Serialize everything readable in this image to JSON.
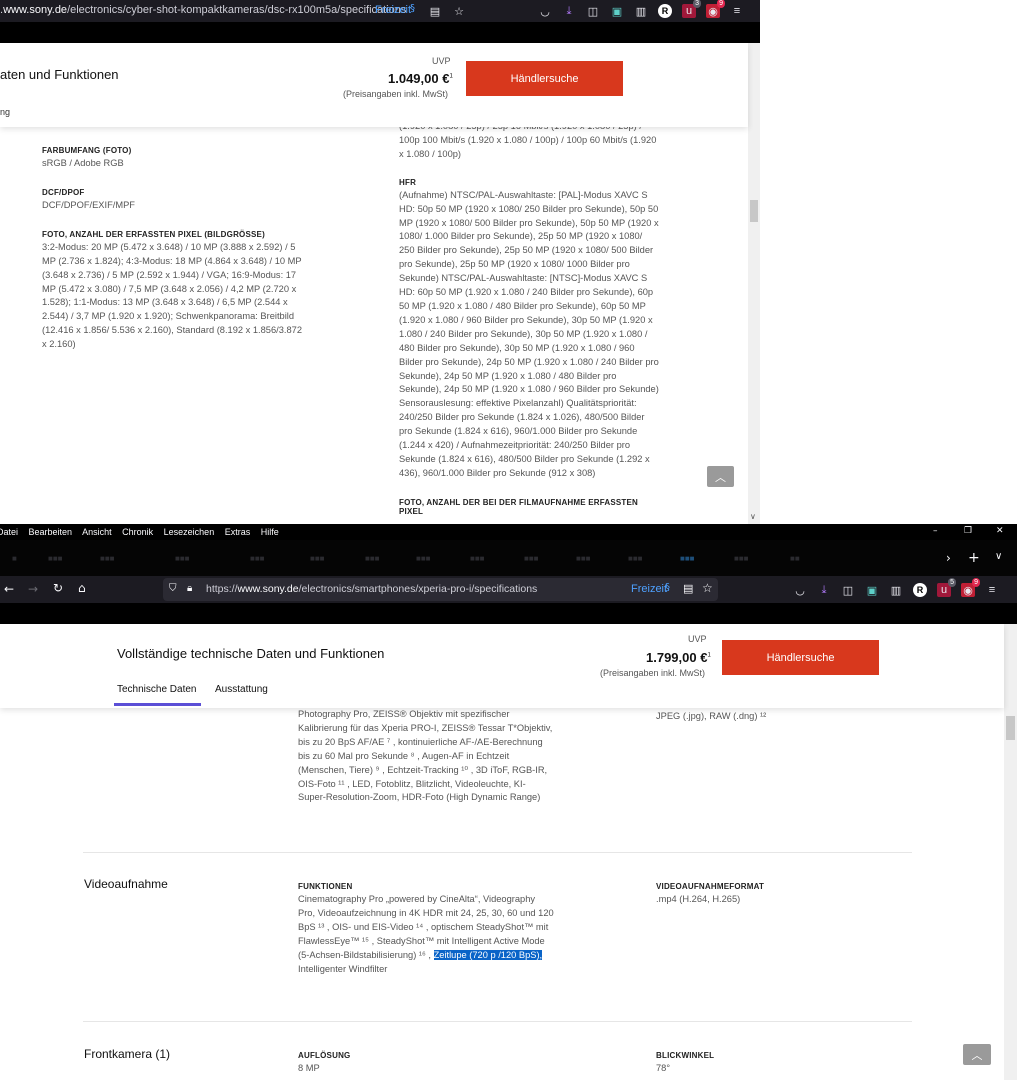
{
  "top_window": {
    "url_host": "www.sony.de",
    "url_path": "/electronics/cyber-shot-kompaktkameras/dsc-rx100m5a/specifications",
    "url_prefix": ".",
    "freizeit_label": "Freizeit",
    "toolbar_badges": {
      "ext1": "3",
      "ext2": "9"
    },
    "header": {
      "title": "aten und Funktionen",
      "tab_fragment": "ng",
      "uvp": "UVP",
      "price": "1.049,00 €",
      "price_sup": "1",
      "inkl": "(Preisangaben inkl. MwSt)",
      "button": "Händlersuche"
    },
    "left_specs": [
      {
        "label": "FARBUMFANG (FOTO)",
        "value": "sRGB / Adobe RGB"
      },
      {
        "label": "DCF/DPOF",
        "value": "DCF/DPOF/EXIF/MPF"
      },
      {
        "label": "FOTO, ANZAHL DER ERFASSTEN PIXEL (BILDGRÖSSE)",
        "value": "3:2-Modus: 20 MP (5.472 x 3.648) / 10 MP (3.888 x 2.592) / 5 MP (2.736 x 1.824); 4:3-Modus: 18 MP (4.864 x 3.648) / 10 MP (3.648 x 2.736) / 5 MP (2.592 x 1.944) / VGA; 16:9-Modus: 17 MP (5.472 x 3.080) / 7,5 MP (3.648 x 2.056) / 4,2 MP (2.720 x 1.528); 1:1-Modus: 13 MP (3.648 x 3.648) / 6,5 MP (2.544 x 2.544) / 3,7 MP (1.920 x 1.920); Schwenkpanorama: Breitbild (12.416 x 1.856/ 5.536 x 2.160), Standard (8.192 x 1.856/3.872 x 2.160)"
      }
    ],
    "right_top_cut": "(1.920 x 1.080 / 25p) / 25p 16 Mbit/s (1.920 x 1.080 / 25p) / 100p 100 Mbit/s (1.920 x 1.080 / 100p) / 100p 60 Mbit/s (1.920 x 1.080 / 100p)",
    "hfr_label": "HFR",
    "hfr_value": "(Aufnahme) NTSC/PAL-Auswahltaste: [PAL]-Modus XAVC S HD: 50p 50 MP (1920 x 1080/ 250 Bilder pro Sekunde), 50p 50 MP (1920 x 1080/ 500 Bilder pro Sekunde), 50p 50 MP (1920 x 1080/ 1.000 Bilder pro Sekunde), 25p 50 MP (1920 x 1080/ 250 Bilder pro Sekunde), 25p 50 MP (1920 x 1080/ 500 Bilder pro Sekunde), 25p 50 MP (1920 x 1080/ 1000 Bilder pro Sekunde) NTSC/PAL-Auswahltaste: [NTSC]-Modus XAVC S HD: 60p 50 MP (1.920 x 1.080 / 240 Bilder pro Sekunde), 60p 50 MP (1.920 x 1.080 / 480 Bilder pro Sekunde), 60p 50 MP (1.920 x 1.080 / 960 Bilder pro Sekunde), 30p 50 MP (1.920 x 1.080 / 240 Bilder pro Sekunde), 30p 50 MP (1.920 x 1.080 / 480 Bilder pro Sekunde), 30p 50 MP (1.920 x 1.080 / 960 Bilder pro Sekunde), 24p 50 MP (1.920 x 1.080 / 240 Bilder pro Sekunde), 24p 50 MP (1.920 x 1.080 / 480 Bilder pro Sekunde), 24p 50 MP (1.920 x 1.080 / 960 Bilder pro Sekunde) Sensorauslesung: effektive Pixelanzahl) Qualitätspriorität: 240/250 Bilder pro Sekunde (1.824 x 1.026), 480/500 Bilder pro Sekunde (1.824 x 616), 960/1.000 Bilder pro Sekunde (1.244 x 420) / Aufnahmezeitpriorität: 240/250 Bilder pro Sekunde (1.824 x 616), 480/500 Bilder pro Sekunde (1.292 x 436), 960/1.000 Bilder pro Sekunde (912 x 308)",
    "bottom_cut_label": "FOTO, ANZAHL DER BEI DER FILMAUFNAHME ERFASSTEN PIXEL"
  },
  "bottom_window": {
    "menu": [
      "Datei",
      "Bearbeiten",
      "Ansicht",
      "Chronik",
      "Lesezeichen",
      "Extras",
      "Hilfe"
    ],
    "url_host": "www.sony.de",
    "url_path": "/electronics/smartphones/xperia-pro-i/specifications",
    "url_scheme": "https://",
    "freizeit_label": "Freizeit",
    "toolbar_badges": {
      "ext1": "5",
      "ext2": "9"
    },
    "header": {
      "title": "Vollständige technische Daten und Funktionen",
      "tabs": [
        "Technische Daten",
        "Ausstattung"
      ],
      "uvp": "UVP",
      "price": "1.799,00 €",
      "price_sup": "1",
      "inkl": "(Preisangaben inkl. MwSt)",
      "button": "Händlersuche"
    },
    "camera_cut_text": "Photography Pro, ZEISS® Objektiv mit spezifischer Kalibrierung für das Xperia PRO-I, ZEISS® Tessar T*Objektiv, bis zu 20 BpS AF/AE ⁷ , kontinuierliche AF-/AE-Berechnung bis zu 60 Mal pro Sekunde ⁸ , Augen-AF in Echtzeit (Menschen, Tiere) ⁹ , Echtzeit-Tracking ¹⁰ , 3D iToF, RGB-IR, OIS-Foto ¹¹ , LED, Fotoblitz, Blitzlicht, Videoleuchte, KI-Super-Resolution-Zoom, HDR-Foto (High Dynamic Range)",
    "camera_format_cut": "JPEG (.jpg), RAW (.dng) ¹²",
    "video": {
      "section_title": "Videoaufnahme",
      "func_label": "FUNKTIONEN",
      "func_text": "Cinematography Pro „powered by CineAlta“, Videography Pro, Videoaufzeichnung in 4K HDR mit 24, 25, 30, 60 und 120 BpS ¹³ , OIS- und EIS-Video ¹⁴ , optischem SteadyShot™ mit FlawlessEye™ ¹⁵ , SteadyShot™ mit Intelligent Active Mode (5-Achsen-Bildstabilisierung) ¹⁶ ,",
      "func_highlight": "Zeitlupe (720 p /120 BpS),",
      "func_tail": "Intelligenter Windfilter",
      "format_label": "VIDEOAUFNAHMEFORMAT",
      "format_value": ".mp4 (H.264, H.265)"
    },
    "front": {
      "section_title": "Frontkamera (1)",
      "res_label": "AUFLÖSUNG",
      "res_value": "8 MP",
      "angle_label": "BLICKWINKEL",
      "angle_value": "78°"
    }
  }
}
